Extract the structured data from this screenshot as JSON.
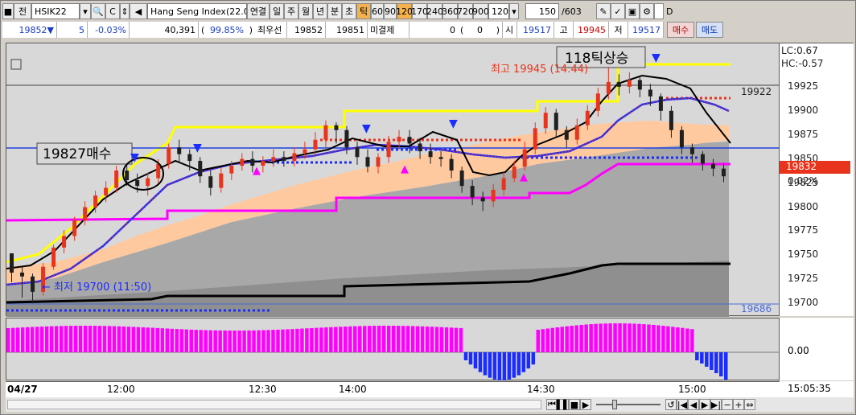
{
  "toolbar1": {
    "type_label": "전",
    "symbol": "HSIK22",
    "index_name": "Hang Seng Index(22.0",
    "continuous": "연결",
    "periods": [
      "일",
      "주",
      "월",
      "년",
      "분",
      "초",
      "틱"
    ],
    "active_period": "틱",
    "tick_sizes": [
      "60",
      "90",
      "120",
      "170",
      "240",
      "360",
      "720",
      "900"
    ],
    "active_tick": "120",
    "tick_select": "120",
    "count": "150",
    "count_total": "/603",
    "checkbox_label": "D"
  },
  "toolbar2": {
    "price": "19852",
    "change_arrow": "▼",
    "change": "5",
    "change_pct": "-0.03%",
    "volume": "40,391",
    "vol_pct_open": "(",
    "vol_pct": "99.85%",
    "vol_pct_close": ")",
    "best_label": "최우선",
    "best_ask": "19852",
    "best_bid": "19851",
    "unsettled_label": "미결제",
    "unsettled": "0",
    "unsettled_paren_open": "(",
    "unsettled_change": "0",
    "unsettled_paren_close": ")",
    "open_label": "시",
    "open": "19517",
    "high_label": "고",
    "high": "19945",
    "low_label": "저",
    "low": "19517",
    "buy_button": "매수",
    "sell_button": "매도"
  },
  "annotations": {
    "ticks_up": "118틱상승",
    "high_note": "최고 19945 (14:44)",
    "buy_note": "19827매수",
    "low_note": "← 최저 19700 (11:50)"
  },
  "yaxis": {
    "lc": "LC:0.67",
    "hc": "HC:-0.57",
    "labels": [
      "19925",
      "19900",
      "19875",
      "19850",
      "19825",
      "19800",
      "19775",
      "19750",
      "19725",
      "19700"
    ],
    "current_price": "19832",
    "current_pct": "0.02%",
    "ref_price_right": "19922",
    "ref_price_bottom": "19686"
  },
  "osc_axis": {
    "zero": "0.00"
  },
  "xaxis": {
    "date": "04/27",
    "labels": [
      "12:00",
      "12:30",
      "14:00",
      "14:30",
      "15:00"
    ],
    "now": "15:05:35"
  },
  "colors": {
    "up": "#e8341c",
    "down": "#202020",
    "ma_black": "#000000",
    "ma_blue": "#1a2cff",
    "yellow": "#ffff00",
    "magenta": "#ff00ff",
    "band": "#ffc9a0",
    "gray_area": "#a8a8a8"
  },
  "chart_data": {
    "type": "candlestick",
    "ylim": [
      19686,
      19970
    ],
    "ticks": [
      "19700",
      "19725",
      "19750",
      "19775",
      "19800",
      "19825",
      "19850",
      "19875",
      "19900",
      "19925"
    ],
    "x_labels": [
      "12:00",
      "12:30",
      "14:00",
      "14:30",
      "15:00"
    ],
    "bars": [
      [
        19752,
        19732,
        19745,
        19722
      ],
      [
        19732,
        19728,
        19738,
        19706
      ],
      [
        19728,
        19712,
        19731,
        19700
      ],
      [
        19712,
        19738,
        19742,
        19708
      ],
      [
        19738,
        19758,
        19761,
        19735
      ],
      [
        19758,
        19770,
        19776,
        19752
      ],
      [
        19770,
        19786,
        19790,
        19765
      ],
      [
        19786,
        19800,
        19806,
        19781
      ],
      [
        19800,
        19812,
        19817,
        19794
      ],
      [
        19812,
        19820,
        19827,
        19805
      ],
      [
        19820,
        19838,
        19843,
        19815
      ],
      [
        19838,
        19828,
        19845,
        19822
      ],
      [
        19828,
        19822,
        19835,
        19815
      ],
      [
        19822,
        19830,
        19836,
        19812
      ],
      [
        19830,
        19845,
        19850,
        19824
      ],
      [
        19845,
        19862,
        19866,
        19840
      ],
      [
        19862,
        19855,
        19870,
        19846
      ],
      [
        19855,
        19848,
        19860,
        19838
      ],
      [
        19848,
        19832,
        19852,
        19825
      ],
      [
        19832,
        19820,
        19838,
        19812
      ],
      [
        19820,
        19835,
        19841,
        19815
      ],
      [
        19835,
        19843,
        19848,
        19828
      ],
      [
        19843,
        19850,
        19856,
        19838
      ],
      [
        19850,
        19843,
        19858,
        19836
      ],
      [
        19843,
        19848,
        19853,
        19836
      ],
      [
        19848,
        19852,
        19860,
        19842
      ],
      [
        19852,
        19848,
        19858,
        19842
      ],
      [
        19848,
        19856,
        19862,
        19842
      ],
      [
        19856,
        19860,
        19868,
        19850
      ],
      [
        19860,
        19870,
        19878,
        19854
      ],
      [
        19870,
        19885,
        19890,
        19862
      ],
      [
        19885,
        19880,
        19888,
        19866
      ],
      [
        19880,
        19862,
        19884,
        19855
      ],
      [
        19862,
        19852,
        19868,
        19844
      ],
      [
        19852,
        19842,
        19860,
        19836
      ],
      [
        19842,
        19852,
        19856,
        19835
      ],
      [
        19852,
        19868,
        19874,
        19846
      ],
      [
        19868,
        19873,
        19880,
        19860
      ],
      [
        19873,
        19866,
        19880,
        19856
      ],
      [
        19866,
        19858,
        19872,
        19850
      ],
      [
        19858,
        19852,
        19866,
        19845
      ],
      [
        19852,
        19850,
        19858,
        19842
      ],
      [
        19850,
        19838,
        19855,
        19830
      ],
      [
        19838,
        19822,
        19842,
        19815
      ],
      [
        19822,
        19810,
        19828,
        19802
      ],
      [
        19810,
        19806,
        19816,
        19796
      ],
      [
        19806,
        19818,
        19824,
        19800
      ],
      [
        19818,
        19830,
        19836,
        19812
      ],
      [
        19830,
        19842,
        19848,
        19826
      ],
      [
        19842,
        19860,
        19868,
        19838
      ],
      [
        19860,
        19882,
        19888,
        19855
      ],
      [
        19882,
        19898,
        19904,
        19876
      ],
      [
        19898,
        19880,
        19902,
        19872
      ],
      [
        19880,
        19870,
        19884,
        19862
      ],
      [
        19870,
        19885,
        19892,
        19865
      ],
      [
        19885,
        19900,
        19906,
        19880
      ],
      [
        19900,
        19918,
        19924,
        19894
      ],
      [
        19918,
        19930,
        19945,
        19912
      ],
      [
        19930,
        19925,
        19938,
        19916
      ],
      [
        19925,
        19932,
        19940,
        19918
      ],
      [
        19932,
        19922,
        19936,
        19914
      ],
      [
        19922,
        19915,
        19928,
        19905
      ],
      [
        19915,
        19900,
        19918,
        19890
      ],
      [
        19900,
        19880,
        19905,
        19872
      ],
      [
        19880,
        19862,
        19884,
        19855
      ],
      [
        19862,
        19855,
        19866,
        19846
      ],
      [
        19855,
        19845,
        19858,
        19838
      ],
      [
        19845,
        19840,
        19850,
        19832
      ],
      [
        19840,
        19832,
        19846,
        19826
      ]
    ]
  }
}
